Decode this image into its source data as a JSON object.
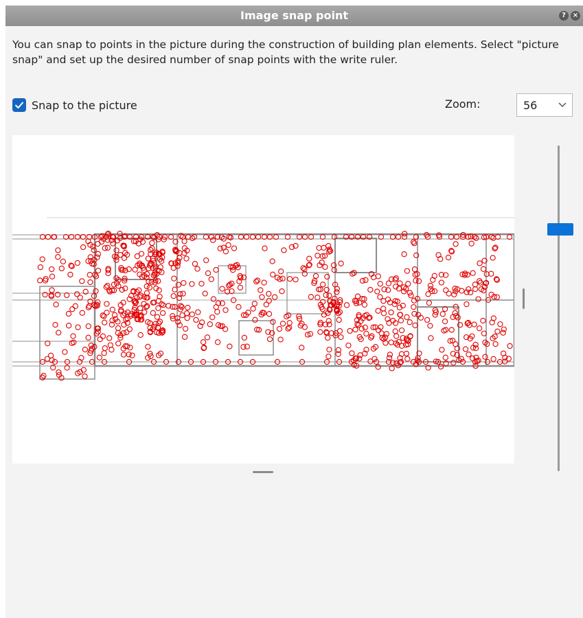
{
  "window": {
    "title": "Image snap point",
    "help_icon": "question-icon",
    "close_icon": "close-icon"
  },
  "description": "You can snap to points in the picture during the construction of building plan elements. Select \"picture snap\" and set up the desired number of snap points with the write ruler.",
  "snap": {
    "checkbox_label": "Snap to the picture",
    "checked": true
  },
  "zoom": {
    "label": "Zoom:",
    "value": "56"
  },
  "snap_density_slider": {
    "level": 0.25
  },
  "colors": {
    "snap_marker": "#e00000",
    "accent": "#0a72d8",
    "checkbox": "#1565c0"
  }
}
